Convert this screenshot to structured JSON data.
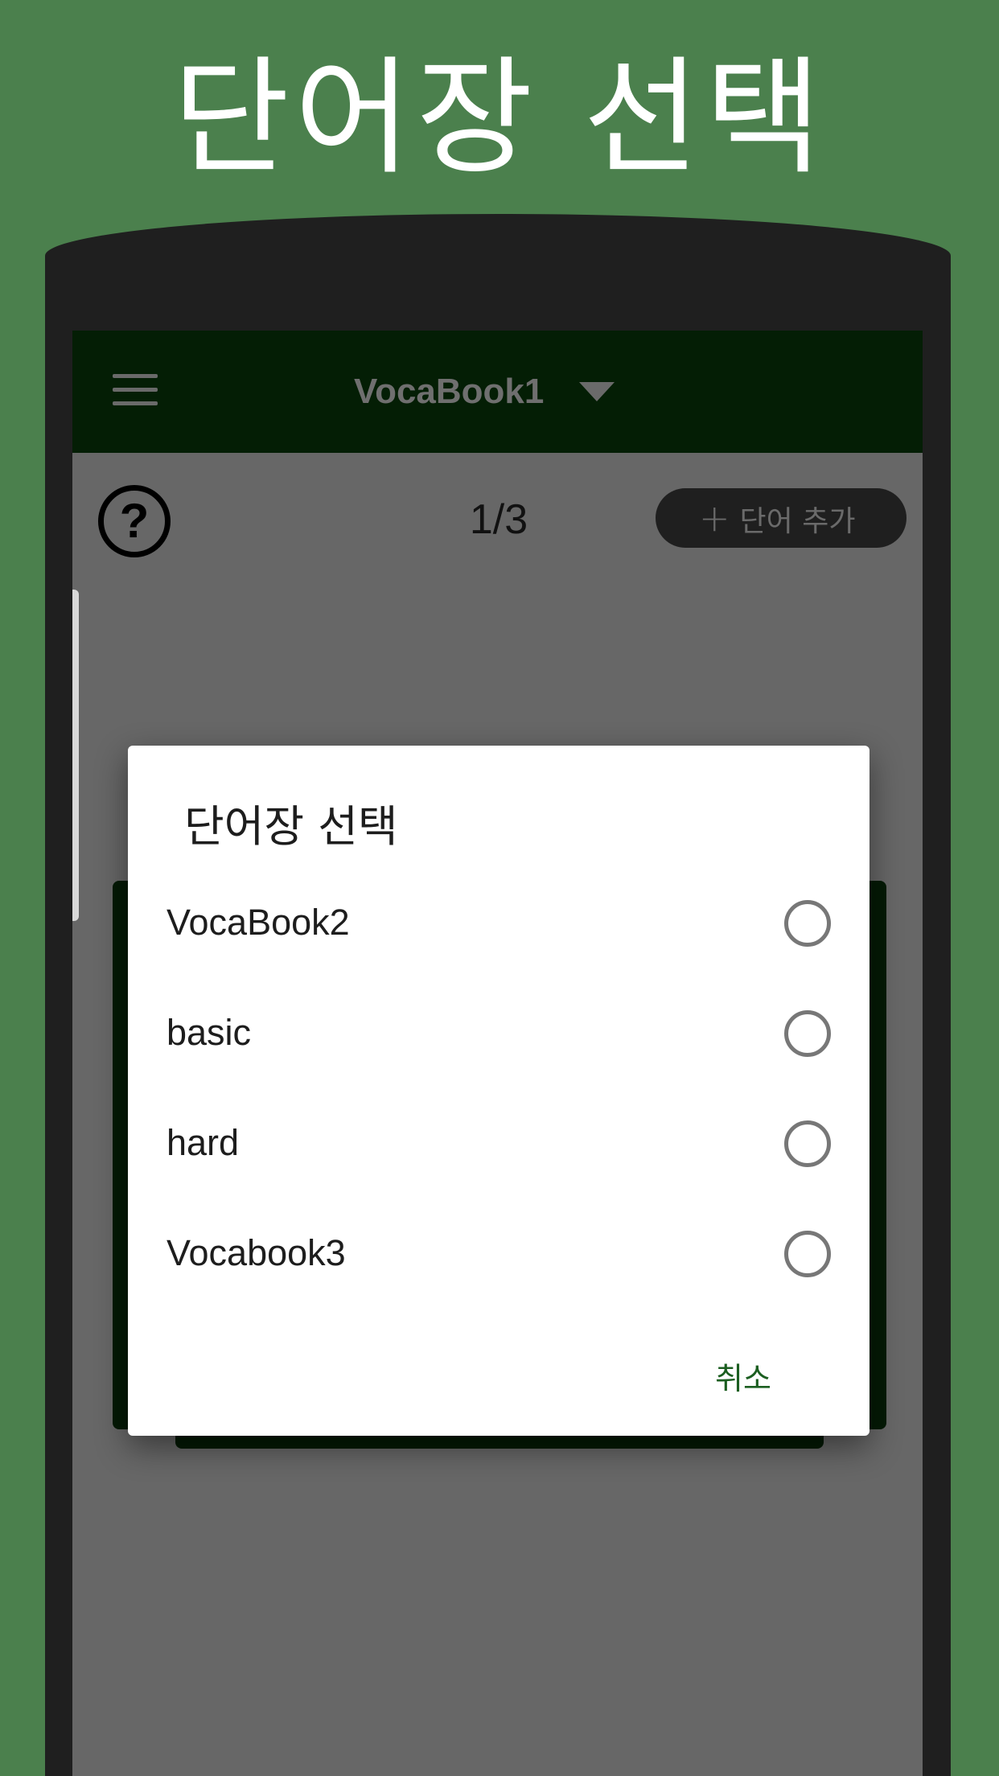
{
  "promo": {
    "title": "단어장 선택"
  },
  "toolbar": {
    "menu_icon": "hamburger-menu-icon",
    "book_title": "VocaBook1",
    "dropdown_icon": "triangle-down-icon"
  },
  "study_bar": {
    "help_icon": "question-circle-icon",
    "page_counter": "1/3",
    "add_word_icon": "plus-icon",
    "add_word_label": "단어 추가"
  },
  "dialog": {
    "title": "단어장 선택",
    "options": [
      {
        "label": "VocaBook2",
        "selected": false
      },
      {
        "label": "basic",
        "selected": false
      },
      {
        "label": "hard",
        "selected": false
      },
      {
        "label": "Vocabook3",
        "selected": false
      }
    ],
    "cancel_label": "취소"
  },
  "colors": {
    "background": "#4b804d",
    "toolbar": "#041e05",
    "accent": "#1b5e20",
    "overlay_screen": "#676767"
  }
}
